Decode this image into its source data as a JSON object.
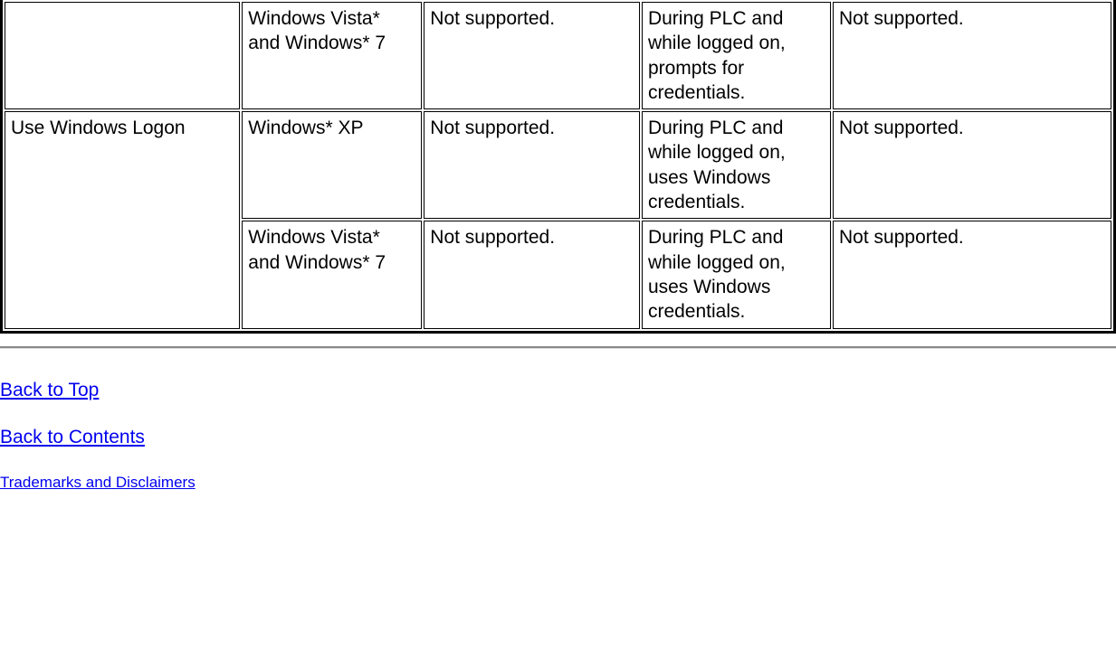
{
  "table": {
    "rows": [
      {
        "c1": "",
        "c2": "Windows Vista* and Windows* 7",
        "c3": "Not supported.",
        "c4": "During PLC and while logged on, prompts for credentials.",
        "c5": "Not supported."
      },
      {
        "c1": "Use Windows Logon",
        "c2": "Windows* XP",
        "c3": "Not supported.",
        "c4": "During PLC and while logged on, uses Windows credentials.",
        "c5": "Not supported."
      },
      {
        "c1": null,
        "c2": "Windows Vista* and Windows* 7",
        "c3": "Not supported.",
        "c4": "During PLC and while logged on, uses Windows credentials.",
        "c5": "Not supported."
      }
    ]
  },
  "links": {
    "back_to_top": "Back to Top",
    "back_to_contents": "Back to Contents",
    "trademarks": "Trademarks and Disclaimers"
  }
}
